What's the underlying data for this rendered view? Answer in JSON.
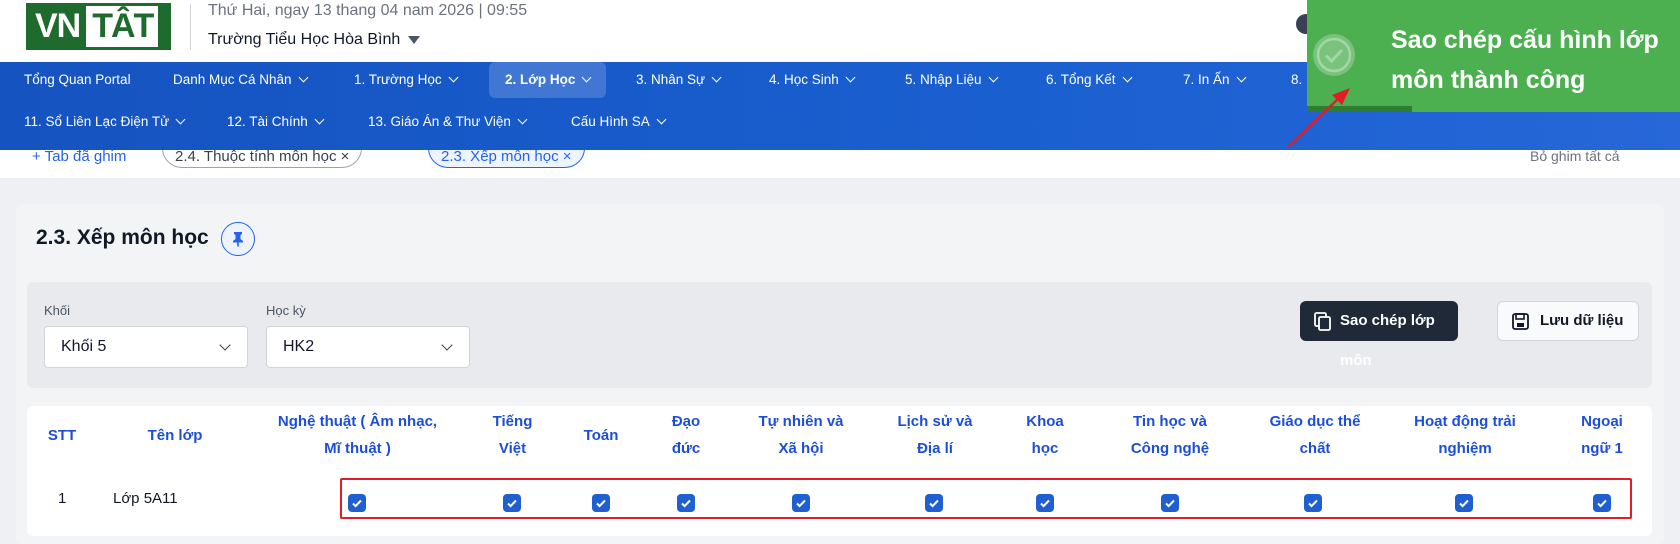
{
  "header": {
    "logo_text_left": "VN",
    "logo_text_right": "TÂT",
    "date": "Thứ Hai, ngay 13 thang 04 nam 2026 | 09:55",
    "school": "Trường Tiểu Học Hòa Bình"
  },
  "nav": {
    "row1": [
      "Tổng Quan Portal",
      "Danh Mục Cá Nhân",
      "1. Trường Học",
      "2. Lớp Học",
      "3. Nhân Sự",
      "4. Học Sinh",
      "5. Nhập Liệu",
      "6. Tổng Kết",
      "7. In Ấn",
      "8."
    ],
    "row2": [
      "11. Sổ Liên Lạc Điện Tử",
      "12. Tài Chính",
      "13. Giáo Án & Thư Viện",
      "Cấu Hình SA"
    ],
    "active": "2. Lớp Học"
  },
  "tabs": {
    "add_label": "Tab đã ghim",
    "items": [
      "2.4. Thuộc tính môn học",
      "2.3. Xếp môn học"
    ],
    "clear_label": "Bỏ ghim tất cả"
  },
  "page": {
    "title": "2.3. Xếp môn học"
  },
  "filters": {
    "grade_label": "Khối",
    "grade_value": "Khối 5",
    "term_label": "Học kỳ",
    "term_value": "HK2"
  },
  "actions": {
    "copy_label": "Sao chép lớp môn",
    "save_label": "Lưu dữ liệu"
  },
  "table": {
    "headers": [
      [
        "STT"
      ],
      [
        "Tên lớp"
      ],
      [
        "Nghệ thuật ( Âm nhạc,",
        "Mĩ thuật )"
      ],
      [
        "Tiếng",
        "Việt"
      ],
      [
        "Toán"
      ],
      [
        "Đạo",
        "đức"
      ],
      [
        "Tự nhiên và",
        "Xã hội"
      ],
      [
        "Lịch sử và",
        "Địa lí"
      ],
      [
        "Khoa",
        "học"
      ],
      [
        "Tin học và",
        "Công nghệ"
      ],
      [
        "Giáo dục thể",
        "chất"
      ],
      [
        "Hoạt động trải",
        "nghiệm"
      ],
      [
        "Ngoại",
        "ngữ 1"
      ]
    ],
    "rows": [
      {
        "stt": "1",
        "name": "Lớp 5A11",
        "checked": [
          true,
          true,
          true,
          true,
          true,
          true,
          true,
          true,
          true,
          true,
          true
        ]
      }
    ]
  },
  "toast": {
    "message": "Sao chép cấu hình lớp môn thành công",
    "color": "#4caf50"
  }
}
